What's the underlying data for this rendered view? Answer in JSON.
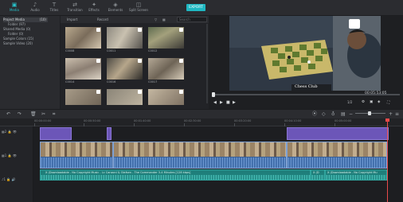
{
  "toolbar": {
    "items": [
      {
        "label": "Media",
        "icon": "media-icon"
      },
      {
        "label": "Audio",
        "icon": "music-note-icon"
      },
      {
        "label": "Titles",
        "icon": "titles-icon"
      },
      {
        "label": "Transition",
        "icon": "transition-icon"
      },
      {
        "label": "Effects",
        "icon": "effects-icon"
      },
      {
        "label": "Elements",
        "icon": "elements-icon"
      },
      {
        "label": "Split Screen",
        "icon": "split-screen-icon"
      }
    ],
    "export_label": "EXPORT",
    "accent": "#27c1c9"
  },
  "sidebar": {
    "items": [
      {
        "label": "Project Media",
        "count": "(10)",
        "selected": true
      },
      {
        "label": "Folder",
        "count": "(97)",
        "selected": false
      },
      {
        "label": "Shared Media",
        "count": "(0)",
        "selected": false
      },
      {
        "label": "Folder",
        "count": "(0)",
        "selected": false
      },
      {
        "label": "Sample Colors",
        "count": "(15)",
        "selected": false
      },
      {
        "label": "Sample Video",
        "count": "(20)",
        "selected": false
      }
    ]
  },
  "media": {
    "import_label": "Import",
    "record_label": "Record",
    "search_placeholder": "Search",
    "thumbs": [
      {
        "label": "C0008"
      },
      {
        "label": "C0011"
      },
      {
        "label": "C0012"
      },
      {
        "label": "C0014"
      },
      {
        "label": "C0016"
      },
      {
        "label": "C0017"
      },
      {
        "label": ""
      },
      {
        "label": ""
      },
      {
        "label": ""
      }
    ]
  },
  "preview": {
    "video_caption": "Chess Club",
    "timecode": "00:05:53:05",
    "ratio": "1/2"
  },
  "timeline": {
    "ruler": [
      "00:00:00:00",
      "00:00:50:00",
      "00:01:40:00",
      "00:02:30:00",
      "00:03:20:00",
      "00:04:10:00",
      "00:05:00:00"
    ],
    "audio_clip_1": "X (Downloadable - No Copyright Music - Lc Canzoni & Olafsen - The Commander 3-4 Minutes [128 kbps]",
    "audio_clip_2": "X (D",
    "audio_clip_3": "X (Downloadable - No Copyright Mu"
  }
}
